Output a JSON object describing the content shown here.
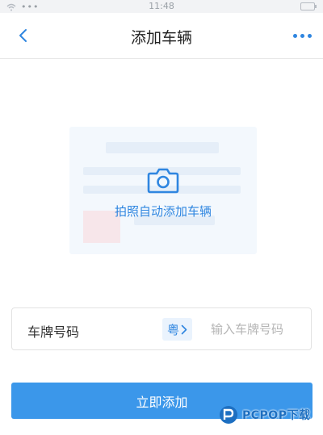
{
  "status_bar": {
    "time": "11:48"
  },
  "nav": {
    "title": "添加车辆",
    "back_icon": "chevron-left-icon",
    "more_icon": "more-dots-icon"
  },
  "photo_card": {
    "label": "拍照自动添加车辆",
    "icon": "camera-icon"
  },
  "plate_field": {
    "label": "车牌号码",
    "province": "粤",
    "province_icon": "chevron-right-icon",
    "placeholder": "输入车牌号码",
    "value": ""
  },
  "submit": {
    "label": "立即添加"
  },
  "watermark": {
    "text": "PCPOP下载"
  },
  "colors": {
    "accent": "#3b97ea",
    "link": "#2f86e0",
    "card_bg": "#f3f8fd"
  }
}
